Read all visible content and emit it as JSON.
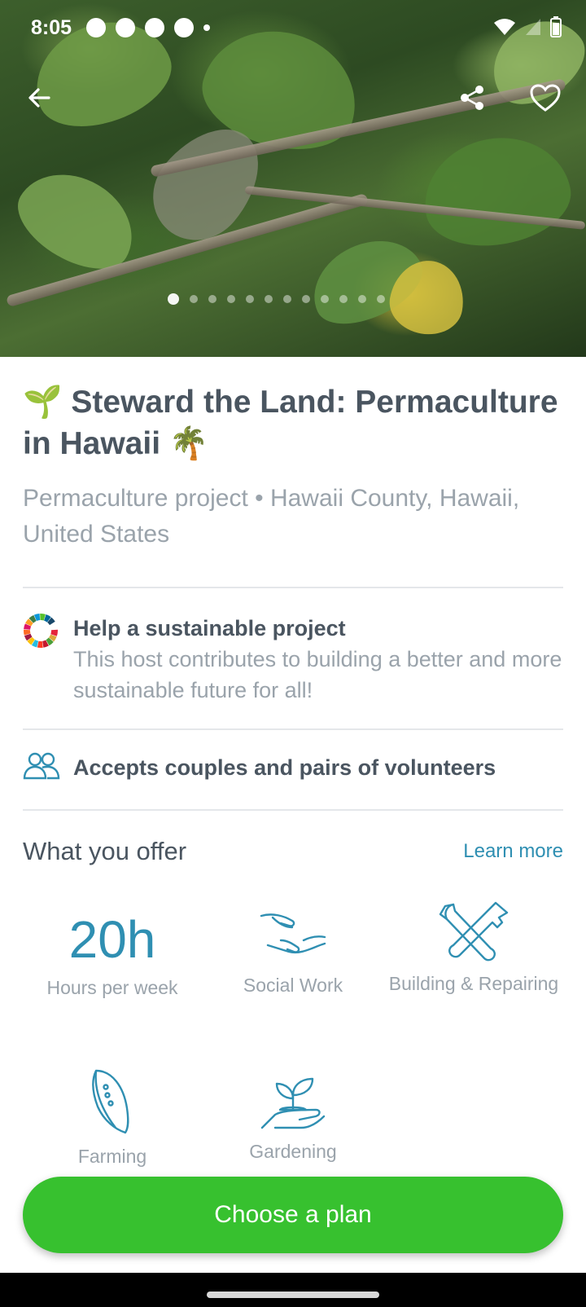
{
  "status_bar": {
    "time": "8:05"
  },
  "header": {
    "back_label": "Back",
    "share_label": "Share",
    "favorite_label": "Favorite",
    "carousel": {
      "total": 12,
      "active_index": 0
    }
  },
  "listing": {
    "title_emoji_start": "🌱",
    "title": "Steward the Land: Permaculture in Hawaii",
    "title_emoji_end": "🌴",
    "subtitle": "Permaculture project • Hawaii County, Hawaii, United States"
  },
  "features": [
    {
      "title": "Help a sustainable project",
      "text": "This host contributes to building a better and more sustainable future for all!",
      "icon": "sdg-wheel-icon"
    },
    {
      "title": "Accepts couples and pairs of volunteers",
      "icon": "couple-icon"
    }
  ],
  "offer": {
    "heading": "What you offer",
    "learn_more": "Learn more",
    "hours_value": "20h",
    "hours_label": "Hours per week",
    "items": [
      {
        "label": "Social Work",
        "icon": "hands-icon"
      },
      {
        "label": "Building & Repairing",
        "icon": "tools-icon"
      },
      {
        "label": "Farming",
        "icon": "corn-icon"
      },
      {
        "label": "Gardening",
        "icon": "plant-in-hand-icon"
      }
    ]
  },
  "cta": {
    "label": "Choose a plan"
  },
  "colors": {
    "accent": "#2f8fb2",
    "cta": "#37c12f",
    "text": "#4a5560",
    "muted": "#9aa3ab"
  }
}
